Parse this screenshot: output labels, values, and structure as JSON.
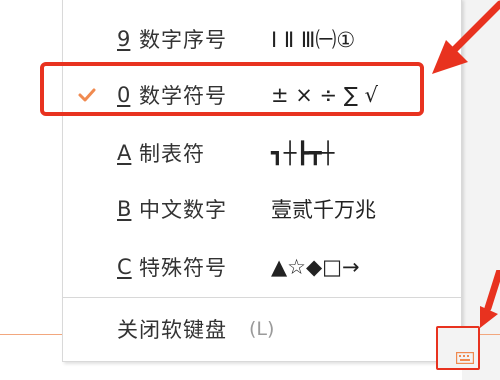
{
  "menu": {
    "items": [
      {
        "key": "9",
        "label": "数字序号",
        "symbols": "Ⅰ Ⅱ Ⅲ㈠①",
        "selected": false
      },
      {
        "key": "0",
        "label": "数学符号",
        "symbols": "± × ÷ ∑ √",
        "selected": true
      },
      {
        "key": "A",
        "label": "制表符",
        "symbols": "┓┼┣┳┼",
        "selected": false
      },
      {
        "key": "B",
        "label": "中文数字",
        "symbols": "壹贰千万兆",
        "selected": false
      },
      {
        "key": "C",
        "label": "特殊符号",
        "symbols": "▲☆◆□→",
        "selected": false
      }
    ],
    "close": {
      "label": "关闭软键盘",
      "hint": "(L)"
    }
  },
  "icons": {
    "check": "check-icon",
    "keyboard": "keyboard-icon"
  },
  "colors": {
    "check": "#f08a50",
    "highlight": "#e8321f",
    "taskbar_line": "#f2a77e"
  }
}
